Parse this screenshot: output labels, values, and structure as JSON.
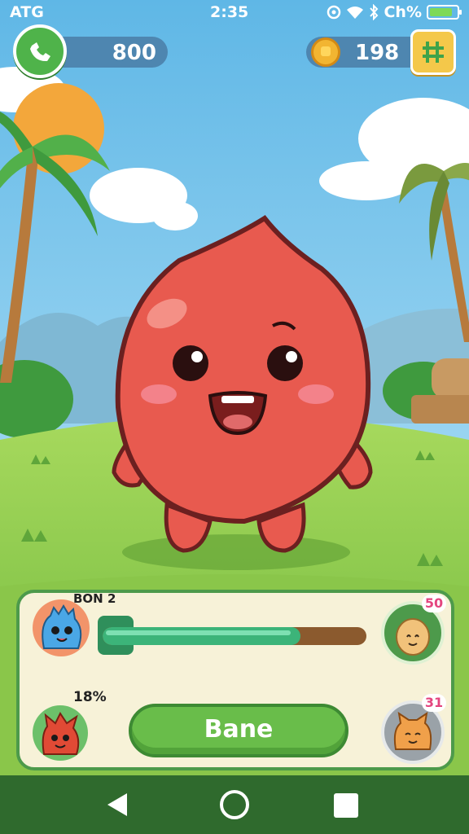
{
  "status_bar": {
    "carrier": "ATG",
    "time": "2:35",
    "battery_text": "Ch%",
    "battery_level": 0.85
  },
  "hud": {
    "left_value": "800",
    "coins": "198",
    "left_icon": "phone-icon",
    "right_icon": "grid-icon"
  },
  "panel": {
    "top_label": "BON 2",
    "percent_label": "18%",
    "badge_top": "50",
    "badge_bottom": "31",
    "progress": 0.75,
    "action_button": "Bane"
  },
  "colors": {
    "accent_green": "#4fb34a",
    "pill_blue": "#4e86b0",
    "monster_red": "#e85a4f",
    "progress_green": "#3cb479"
  }
}
